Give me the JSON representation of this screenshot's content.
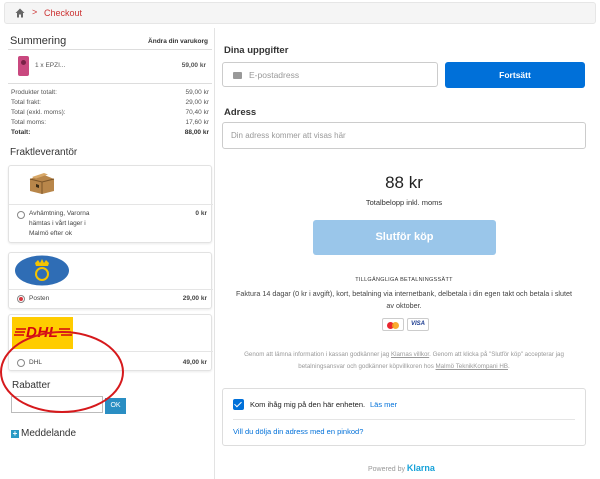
{
  "breadcrumb": {
    "separator": ">",
    "current": "Checkout",
    "icon": "home-icon"
  },
  "summary": {
    "title": "Summering",
    "edit_cart": "Ändra din varukorg",
    "product": {
      "name": "1 x EPZI...",
      "price": "59,00 kr"
    },
    "totals": [
      {
        "label": "Produkter totalt:",
        "value": "59,00 kr",
        "bold": false
      },
      {
        "label": "Total frakt:",
        "value": "29,00 kr",
        "bold": false
      },
      {
        "label": "Total (exkl. moms):",
        "value": "70,40 kr",
        "bold": false
      },
      {
        "label": "Total moms:",
        "value": "17,60 kr",
        "bold": false
      },
      {
        "label": "Totalt:",
        "value": "88,00 kr",
        "bold": true
      }
    ]
  },
  "shipping": {
    "title": "Fraktleverantör",
    "options": [
      {
        "name": "Avhämtning, Varorna hämtas i vårt lager i Malmö efter ok",
        "lines": [
          "Avhämtning, Varorna",
          "hämtas i vårt lager i",
          "Malmö efter ok"
        ],
        "price": "0 kr",
        "selected": false
      },
      {
        "name": "Posten",
        "price": "29,00 kr",
        "selected": true
      },
      {
        "name": "DHL",
        "price": "49,00 kr",
        "selected": false
      }
    ],
    "dhl_logo_text": "DHL"
  },
  "discount": {
    "title": "Rabatter",
    "input_value": "",
    "ok_label": "OK"
  },
  "message": {
    "label": "Meddelande",
    "plus": "+"
  },
  "klarna": {
    "your_details": "Dina uppgifter",
    "email_placeholder": "E-postadress",
    "continue_label": "Fortsätt",
    "address_title": "Adress",
    "address_placeholder": "Din adress kommer att visas här",
    "amount": "88 kr",
    "amount_sub": "Totalbelopp inkl. moms",
    "pay_label": "Slutför köp",
    "payment_methods_title": "TILLGÄNGLIGA BETALNINGSSÄTT",
    "payment_methods_desc": "Faktura 14 dagar (0 kr i avgift), kort, betalning via internetbank, delbetala i din egen takt och betala i slutet av oktober.",
    "card_mc": "MasterCard",
    "card_visa": "VISA",
    "terms_part1": "Genom att lämna information i kassan godkänner jag",
    "terms_link1": "Klarnas villkor",
    "terms_part2": ". Genom att klicka på \"Slutför köp\" accepterar jag betalningsansvar och godkänner köpvillkoren hos",
    "terms_link2": "Malmö TeknikKompani HB",
    "terms_part3": ".",
    "remember_label": "Kom ihåg mig på den här enheten.",
    "remember_more": "Läs mer",
    "remember_checked": true,
    "hide_address": "Vill du dölja din adress med en pinkod?",
    "powered_by": "Powered by",
    "klarna_logo": "Klarna"
  },
  "colors": {
    "accent_blue": "#0070d9",
    "disabled_blue": "#9ac6ea",
    "crumb_red": "#cc3333",
    "annotation_red": "#d6191c",
    "dhl_yellow": "#ffcc00",
    "dhl_red": "#d40511",
    "posten_blue": "#2f6db5"
  }
}
